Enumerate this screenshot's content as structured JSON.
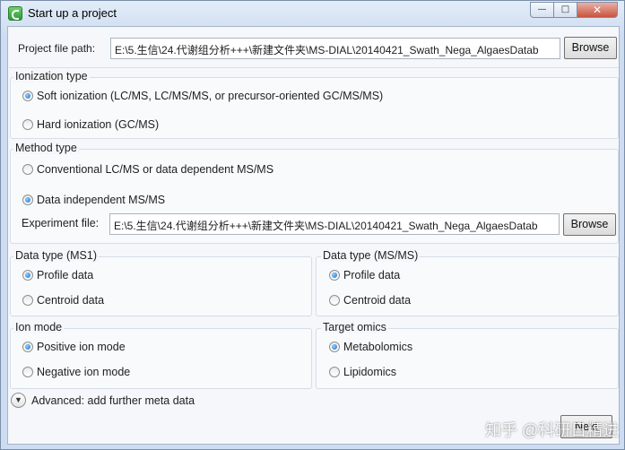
{
  "window": {
    "title": "Start up a project",
    "min_symbol": "—",
    "max_symbol": "□",
    "close_symbol": "✕"
  },
  "project": {
    "label": "Project file path:",
    "value": "E:\\5.生信\\24.代谢组分析+++\\新建文件夹\\MS-DIAL\\20140421_Swath_Nega_AlgaesDatab",
    "browse_label": "Browse"
  },
  "ionization": {
    "title": "Ionization type",
    "options": [
      {
        "label": "Soft ionization (LC/MS, LC/MS/MS, or precursor-oriented GC/MS/MS)",
        "selected": true
      },
      {
        "label": "Hard ionization (GC/MS)",
        "selected": false
      }
    ]
  },
  "method": {
    "title": "Method type",
    "options": [
      {
        "label": "Conventional LC/MS or data dependent MS/MS",
        "selected": false
      },
      {
        "label": "Data independent MS/MS",
        "selected": true
      }
    ],
    "experiment_label": "Experiment file:",
    "experiment_value": "E:\\5.生信\\24.代谢组分析+++\\新建文件夹\\MS-DIAL\\20140421_Swath_Nega_AlgaesDatab",
    "browse_label": "Browse"
  },
  "ms1": {
    "title": "Data type (MS1)",
    "options": [
      {
        "label": "Profile data",
        "selected": true
      },
      {
        "label": "Centroid data",
        "selected": false
      }
    ]
  },
  "msms": {
    "title": "Data type (MS/MS)",
    "options": [
      {
        "label": "Profile data",
        "selected": true
      },
      {
        "label": "Centroid data",
        "selected": false
      }
    ]
  },
  "ion_mode": {
    "title": "Ion mode",
    "options": [
      {
        "label": "Positive ion mode",
        "selected": true
      },
      {
        "label": "Negative ion mode",
        "selected": false
      }
    ]
  },
  "target_omics": {
    "title": "Target omics",
    "options": [
      {
        "label": "Metabolomics",
        "selected": true
      },
      {
        "label": "Lipidomics",
        "selected": false
      }
    ]
  },
  "advanced": {
    "label": "Advanced: add further meta data",
    "icon": "chevron-down-icon"
  },
  "footer": {
    "next_label": "Next",
    "watermark": "知乎 @科研日精进"
  }
}
